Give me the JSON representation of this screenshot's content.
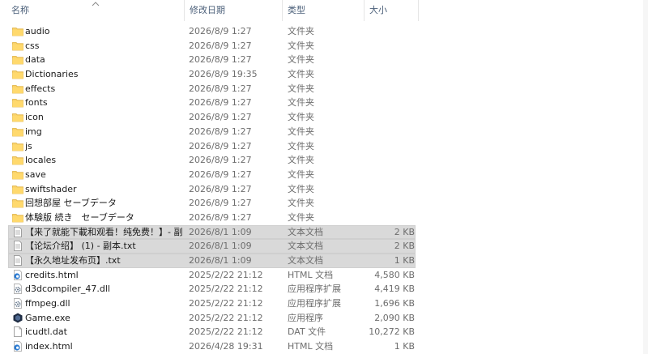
{
  "header": {
    "name": "名称",
    "date": "修改日期",
    "type": "类型",
    "size": "大小"
  },
  "files": [
    {
      "name": "audio",
      "date": "2026/8/9 1:27",
      "type": "文件夹",
      "size": "",
      "icon": "folder-icon"
    },
    {
      "name": "css",
      "date": "2026/8/9 1:27",
      "type": "文件夹",
      "size": "",
      "icon": "folder-icon"
    },
    {
      "name": "data",
      "date": "2026/8/9 1:27",
      "type": "文件夹",
      "size": "",
      "icon": "folder-icon"
    },
    {
      "name": "Dictionaries",
      "date": "2026/8/9 19:35",
      "type": "文件夹",
      "size": "",
      "icon": "folder-icon"
    },
    {
      "name": "effects",
      "date": "2026/8/9 1:27",
      "type": "文件夹",
      "size": "",
      "icon": "folder-icon"
    },
    {
      "name": "fonts",
      "date": "2026/8/9 1:27",
      "type": "文件夹",
      "size": "",
      "icon": "folder-icon"
    },
    {
      "name": "icon",
      "date": "2026/8/9 1:27",
      "type": "文件夹",
      "size": "",
      "icon": "folder-icon"
    },
    {
      "name": "img",
      "date": "2026/8/9 1:27",
      "type": "文件夹",
      "size": "",
      "icon": "folder-icon"
    },
    {
      "name": "js",
      "date": "2026/8/9 1:27",
      "type": "文件夹",
      "size": "",
      "icon": "folder-icon"
    },
    {
      "name": "locales",
      "date": "2026/8/9 1:27",
      "type": "文件夹",
      "size": "",
      "icon": "folder-icon"
    },
    {
      "name": "save",
      "date": "2026/8/9 1:27",
      "type": "文件夹",
      "size": "",
      "icon": "folder-icon"
    },
    {
      "name": "swiftshader",
      "date": "2026/8/9 1:27",
      "type": "文件夹",
      "size": "",
      "icon": "folder-icon"
    },
    {
      "name": "回想部屋 セーブデータ",
      "date": "2026/8/9 1:27",
      "type": "文件夹",
      "size": "",
      "icon": "folder-icon"
    },
    {
      "name": "体験版 続き　セーブデータ",
      "date": "2026/8/9 1:27",
      "type": "文件夹",
      "size": "",
      "icon": "folder-icon"
    },
    {
      "name": "【来了就能下載和观看！纯免费！】- 副...",
      "date": "2026/8/1 1:09",
      "type": "文本文档",
      "size": "2 KB",
      "icon": "text-file-icon",
      "selected": true
    },
    {
      "name": "【论坛介绍】 (1) - 副本.txt",
      "date": "2026/8/1 1:09",
      "type": "文本文档",
      "size": "2 KB",
      "icon": "text-file-icon",
      "selected": true
    },
    {
      "name": "【永久地址发布页】.txt",
      "date": "2026/8/1 1:09",
      "type": "文本文档",
      "size": "1 KB",
      "icon": "text-file-icon",
      "selected": true
    },
    {
      "name": "credits.html",
      "date": "2025/2/22 21:12",
      "type": "HTML 文档",
      "size": "4,580 KB",
      "icon": "edge-html-icon"
    },
    {
      "name": "d3dcompiler_47.dll",
      "date": "2025/2/22 21:12",
      "type": "应用程序扩展",
      "size": "4,419 KB",
      "icon": "dll-gear-icon"
    },
    {
      "name": "ffmpeg.dll",
      "date": "2025/2/22 21:12",
      "type": "应用程序扩展",
      "size": "1,696 KB",
      "icon": "dll-gear-icon"
    },
    {
      "name": "Game.exe",
      "date": "2025/2/22 21:12",
      "type": "应用程序",
      "size": "2,090 KB",
      "icon": "game-app-icon"
    },
    {
      "name": "icudtl.dat",
      "date": "2025/2/22 21:12",
      "type": "DAT 文件",
      "size": "10,272 KB",
      "icon": "blank-file-icon"
    },
    {
      "name": "index.html",
      "date": "2026/4/28 19:31",
      "type": "HTML 文档",
      "size": "1 KB",
      "icon": "edge-html-icon"
    }
  ]
}
